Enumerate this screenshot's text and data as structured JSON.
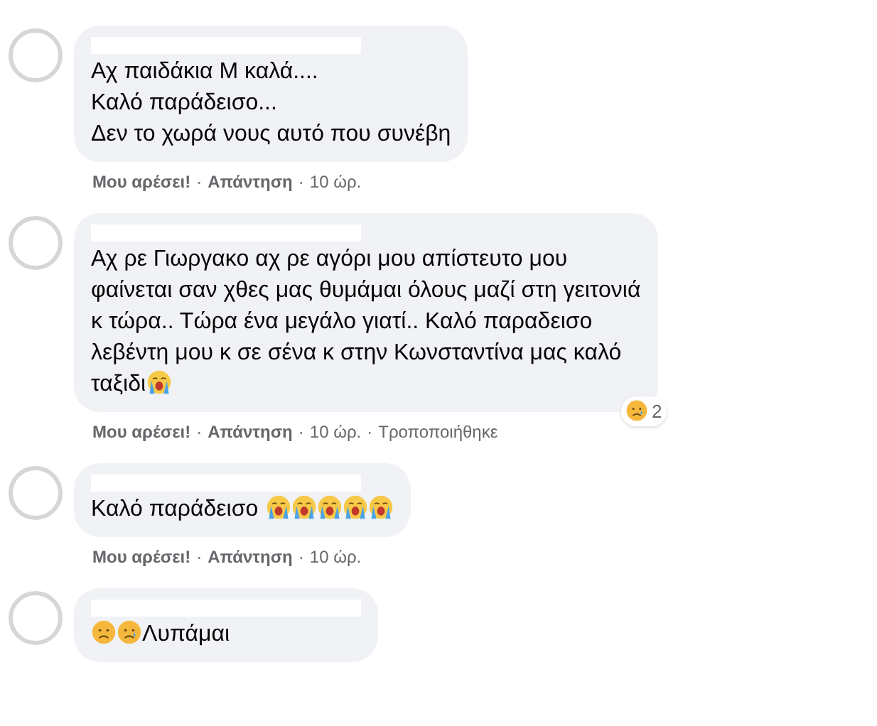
{
  "separator": "·",
  "comments": [
    {
      "lines": [
        [
          {
            "kind": "text",
            "text": "Αχ παιδάκια Μ καλά...."
          }
        ],
        [
          {
            "kind": "text",
            "text": "Καλό παράδεισο..."
          }
        ],
        [
          {
            "kind": "text",
            "text": "Δεν το χωρά νους αυτό που συνέβη"
          }
        ]
      ],
      "actions": {
        "like": "Μου αρέσει!",
        "reply": "Απάντηση",
        "time": "10 ώρ."
      }
    },
    {
      "lines": [
        [
          {
            "kind": "text",
            "text": "Αχ ρε Γιωργακο αχ ρε αγόρι μου απίστευτο μου"
          }
        ],
        [
          {
            "kind": "text",
            "text": "φαίνεται σαν χθες μας θυμάμαι όλους μαζί στη γειτονιά"
          }
        ],
        [
          {
            "kind": "text",
            "text": "κ τώρα.. Τώρα ένα μεγάλο γιατί.. Καλό παραδεισο"
          }
        ],
        [
          {
            "kind": "text",
            "text": "λεβέντη μου κ σε σένα κ στην Κωνσταντίνα μας καλό"
          }
        ],
        [
          {
            "kind": "text",
            "text": "ταξιδι"
          },
          {
            "kind": "crying"
          }
        ]
      ],
      "reaction": {
        "count": "2"
      },
      "actions": {
        "like": "Μου αρέσει!",
        "reply": "Απάντηση",
        "time": "10 ώρ.",
        "edited": "Τροποποιήθηκε"
      }
    },
    {
      "lines": [
        [
          {
            "kind": "text",
            "text": "Καλό παράδεισο"
          },
          {
            "kind": "space"
          },
          {
            "kind": "crying"
          },
          {
            "kind": "crying"
          },
          {
            "kind": "crying"
          },
          {
            "kind": "crying"
          },
          {
            "kind": "crying"
          }
        ]
      ],
      "actions": {
        "like": "Μου αρέσει!",
        "reply": "Απάντηση",
        "time": "10 ώρ."
      }
    },
    {
      "lines": [
        [
          {
            "kind": "sad"
          },
          {
            "kind": "tear"
          },
          {
            "kind": "text",
            "text": "Λυπάμαι"
          }
        ]
      ]
    }
  ]
}
